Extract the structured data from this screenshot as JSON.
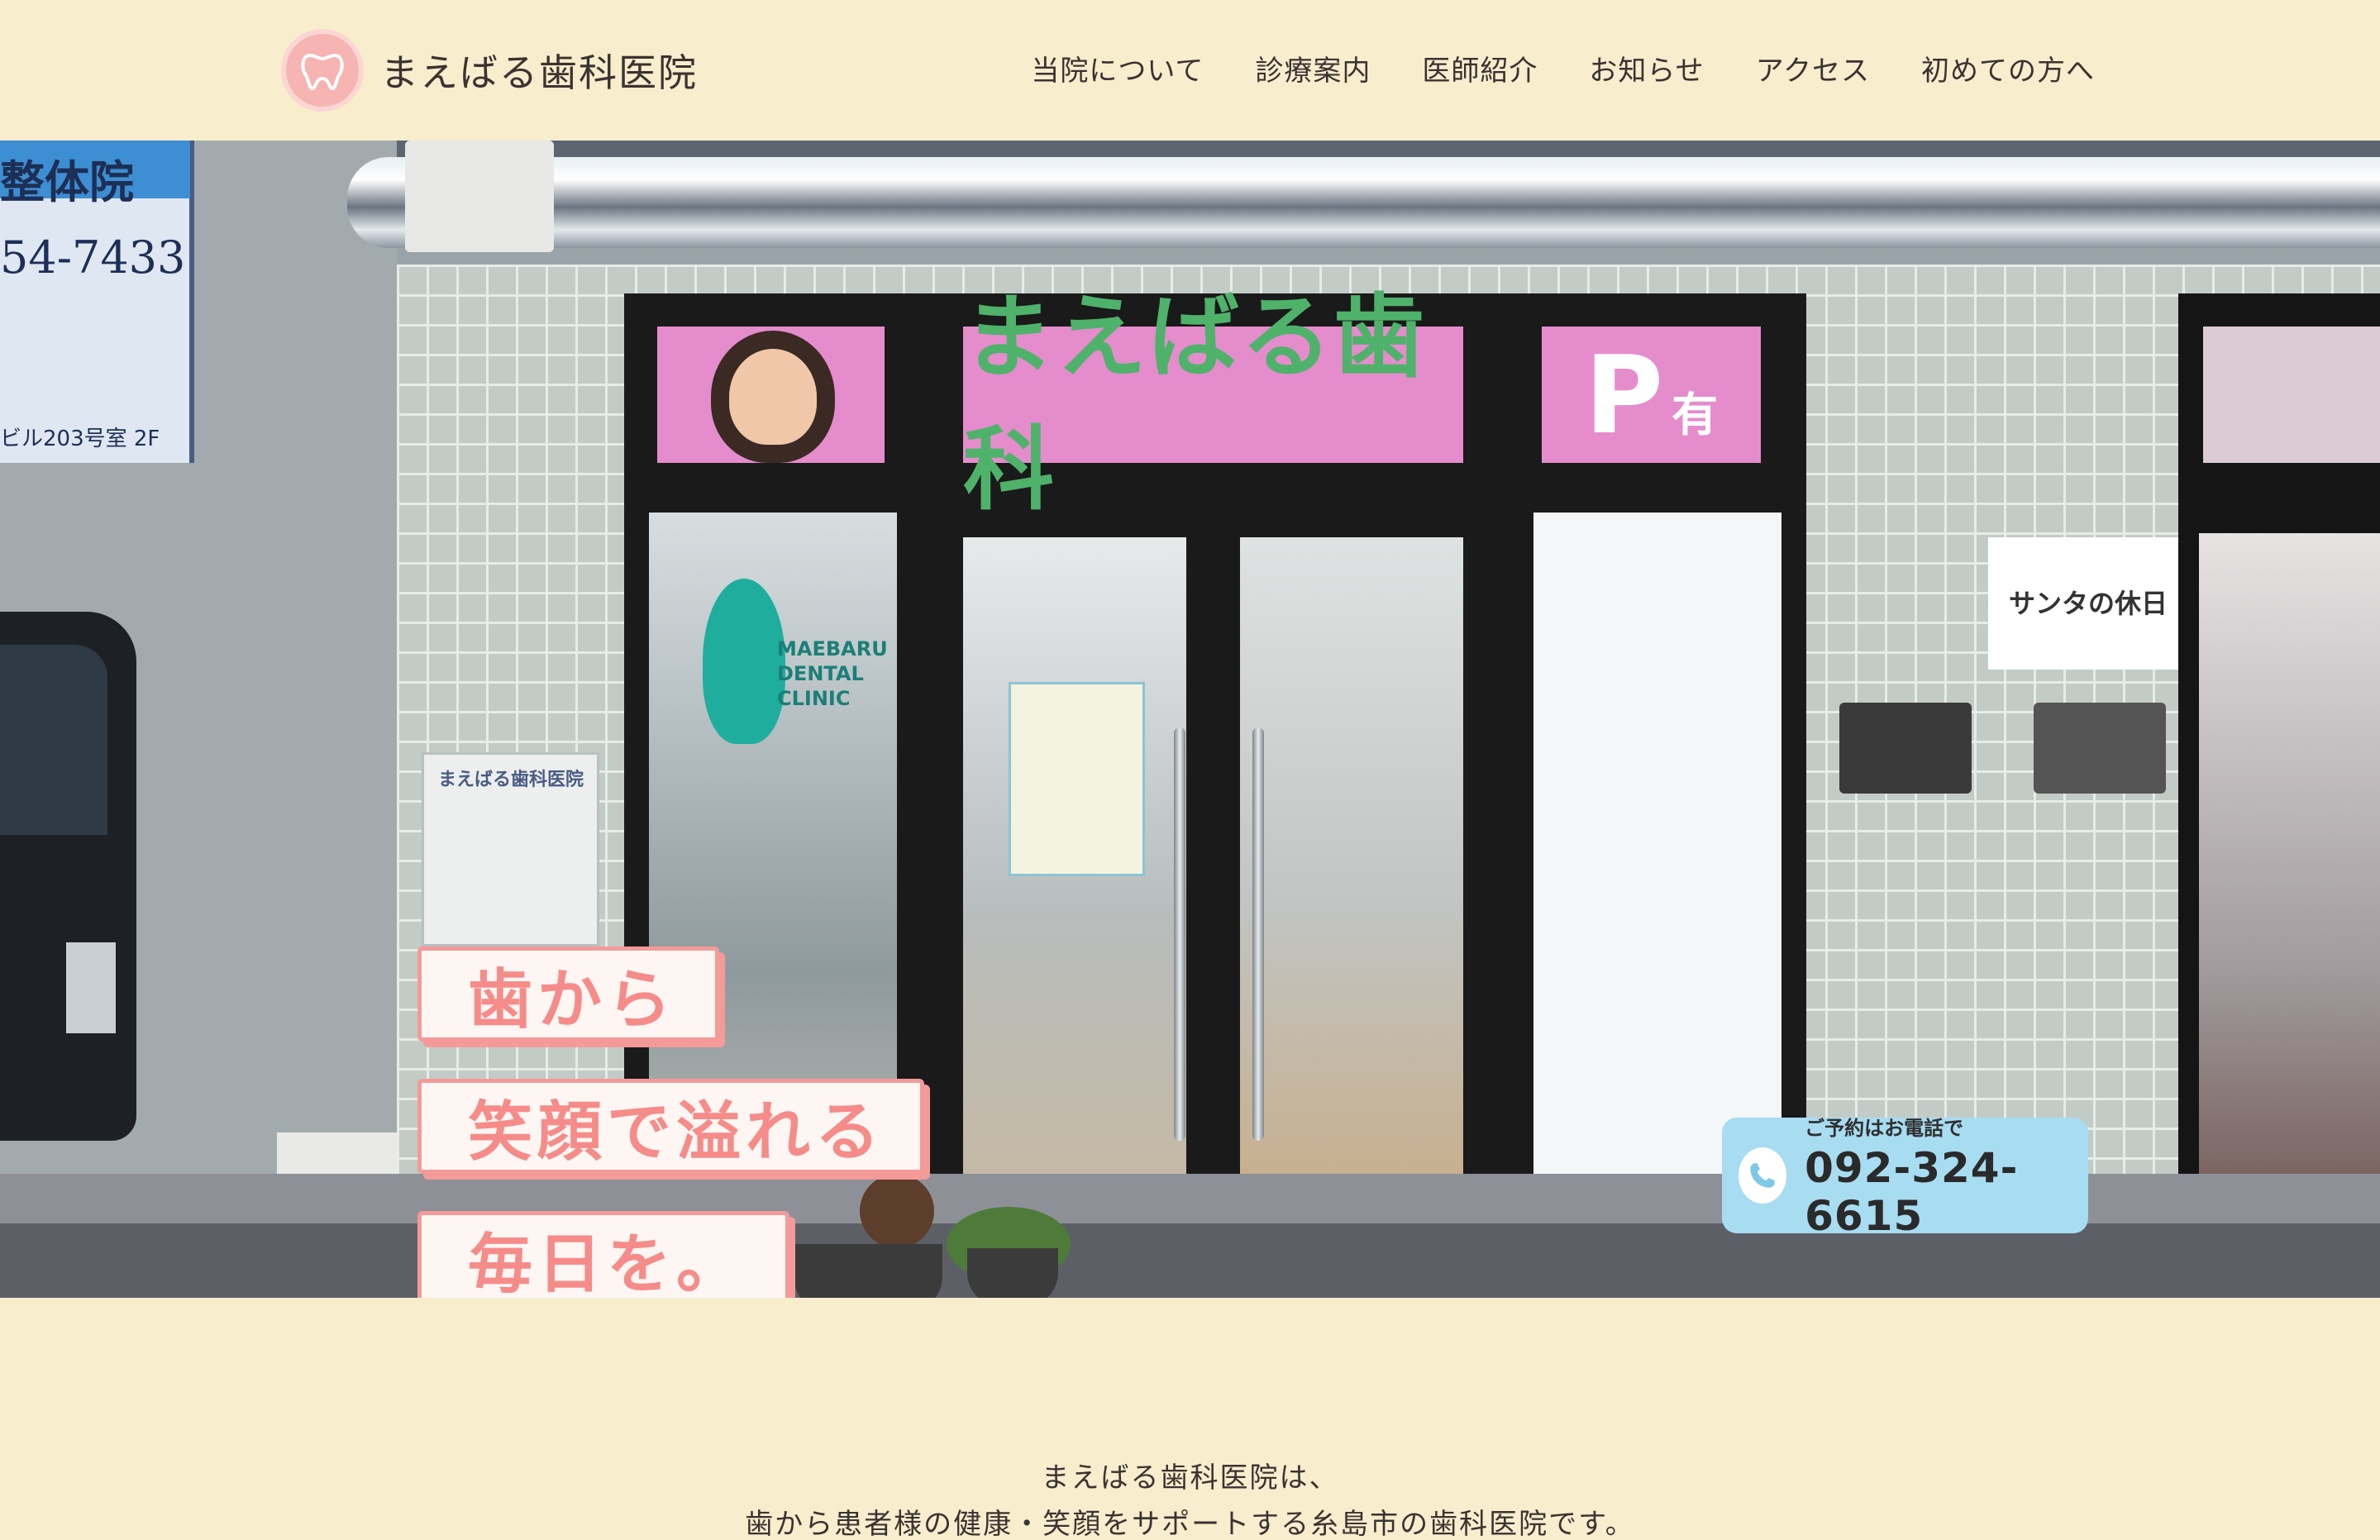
{
  "header": {
    "logo_text": "まえばる歯科医院",
    "logo_ring_text": "MAEBARU DENTAL CLINIC",
    "nav": [
      {
        "label": "当院について"
      },
      {
        "label": "診療案内"
      },
      {
        "label": "医師紹介"
      },
      {
        "label": "お知らせ"
      },
      {
        "label": "アクセス"
      },
      {
        "label": "初めての方へ"
      }
    ]
  },
  "hero": {
    "storefront": {
      "shop_sign": "まえばる歯科",
      "parking_sign_letter": "P",
      "parking_sign_note": "有",
      "door_logo": "MAEBARU DENTAL CLINIC",
      "side_sign": "サンタの休日",
      "neighbor_sign_top": "整体院",
      "neighbor_sign_phone": "54-7433",
      "neighbor_sign_address": "ビル203号室 2F",
      "wall_plate": "まえばる歯科医院"
    },
    "catch_lines": [
      "歯から",
      "笑顔で溢れる",
      "毎日を。"
    ],
    "tel": {
      "label": "ご予約はお電話で",
      "number": "092-324-6615",
      "icon": "phone-icon"
    }
  },
  "intro": {
    "lines": [
      "まえばる歯科医院は、",
      "歯から患者様の健康・笑顔をサポートする糸島市の歯科医院です。"
    ]
  },
  "colors": {
    "background": "#f8edcd",
    "accent_pink": "#f49a99",
    "tel_blue": "#a8dcf1",
    "text": "#3a3330"
  }
}
